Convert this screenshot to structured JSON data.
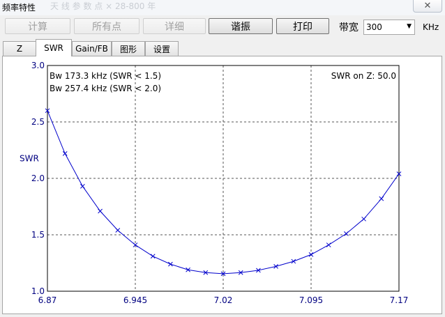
{
  "window": {
    "title": "频率特性",
    "ghost_text": "天 线 参 数 点 × 28-800 年",
    "close_glyph": "✕"
  },
  "toolbar": {
    "buttons": [
      {
        "label": "计算",
        "enabled": false
      },
      {
        "label": "所有点",
        "enabled": false
      },
      {
        "label": "详细",
        "enabled": false
      },
      {
        "label": "谐振",
        "enabled": true
      },
      {
        "label": "打印",
        "enabled": true
      }
    ],
    "bandwidth_label": "带宽",
    "bandwidth_value": "300",
    "bandwidth_unit": "KHz"
  },
  "tabs": [
    {
      "label": "Z",
      "selected": false
    },
    {
      "label": "SWR",
      "selected": true
    },
    {
      "label": "Gain/FB",
      "selected": false
    },
    {
      "label": "图形",
      "selected": false
    },
    {
      "label": "设置",
      "selected": false
    }
  ],
  "chart_data": {
    "type": "line",
    "ylabel": "SWR",
    "xlabel": "",
    "xlim": [
      6.87,
      7.17
    ],
    "ylim": [
      1.0,
      3.0
    ],
    "x_ticks": [
      "6.87",
      "6.945",
      "7.02",
      "7.095",
      "7.17"
    ],
    "y_ticks": [
      "1.0",
      "1.5",
      "2.0",
      "2.5",
      "3.0"
    ],
    "grid": true,
    "annotations": {
      "bw1": "Bw 173.3 kHz (SWR < 1.5)",
      "bw2": "Bw 257.4 kHz (SWR < 2.0)",
      "swr_on_z": "SWR on Z: 50.0"
    },
    "series": [
      {
        "color": "#0000cc",
        "x": [
          6.87,
          6.885,
          6.9,
          6.915,
          6.93,
          6.945,
          6.96,
          6.975,
          6.99,
          7.005,
          7.02,
          7.035,
          7.05,
          7.065,
          7.08,
          7.095,
          7.11,
          7.125,
          7.14,
          7.155,
          7.17
        ],
        "y": [
          2.6,
          2.22,
          1.93,
          1.71,
          1.54,
          1.41,
          1.31,
          1.24,
          1.19,
          1.165,
          1.155,
          1.165,
          1.185,
          1.22,
          1.265,
          1.325,
          1.41,
          1.51,
          1.64,
          1.82,
          2.04
        ]
      }
    ]
  },
  "colors": {
    "plot_line": "#0000cc",
    "axis_text": "#000080",
    "grid": "#555555"
  }
}
